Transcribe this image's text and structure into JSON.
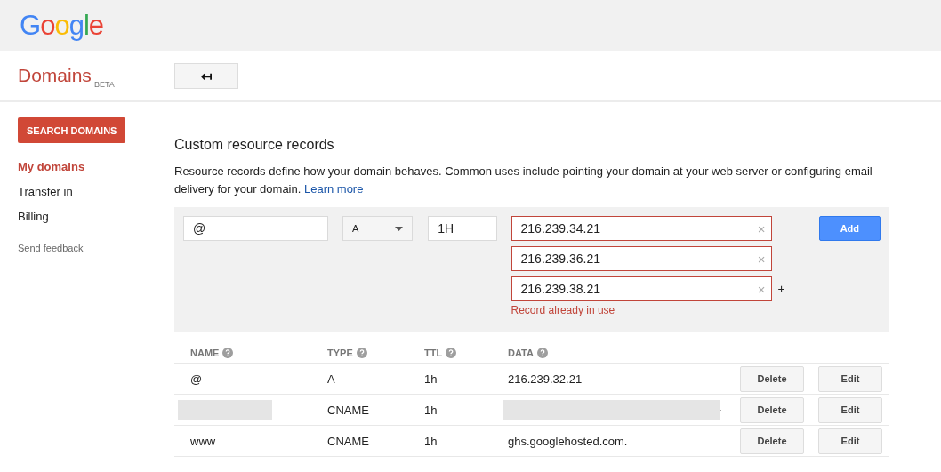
{
  "logo": "Google",
  "product": {
    "title": "Domains",
    "badge": "BETA"
  },
  "back_button": "↤",
  "sidebar": {
    "search_button": "SEARCH DOMAINS",
    "items": [
      {
        "label": "My domains",
        "selected": true
      },
      {
        "label": "Transfer in",
        "selected": false
      },
      {
        "label": "Billing",
        "selected": false
      }
    ],
    "feedback": "Send feedback"
  },
  "section_title": "Custom resource records",
  "description": {
    "text": "Resource records define how your domain behaves. Common uses include pointing your domain at your web server or configuring email delivery for your domain.",
    "link": "Learn more"
  },
  "editor": {
    "name": "@",
    "type": "A",
    "ttl": "1H",
    "data": [
      {
        "value": "216.239.34.21",
        "error": true
      },
      {
        "value": "216.239.36.21",
        "error": true
      },
      {
        "value": "216.239.38.21",
        "error": true
      }
    ],
    "plus": "+",
    "clear": "×",
    "error_message": "Record already in use",
    "add_button": "Add"
  },
  "table": {
    "columns": [
      "NAME",
      "TYPE",
      "TTL",
      "DATA"
    ],
    "rows": [
      {
        "name": "@",
        "name_redacted": false,
        "type": "A",
        "ttl": "1h",
        "data": "216.239.32.21",
        "data_redacted": false,
        "delete_button": "Delete",
        "edit_button": "Edit"
      },
      {
        "name_redacted": true,
        "type": "CNAME",
        "ttl": "1h",
        "data": ".",
        "data_redacted": true,
        "delete_button": "Delete",
        "edit_button": "Edit"
      },
      {
        "name": "www",
        "name_redacted": false,
        "type": "CNAME",
        "ttl": "1h",
        "data": "ghs.googlehosted.com.",
        "data_redacted": false,
        "delete_button": "Delete",
        "edit_button": "Edit"
      }
    ]
  }
}
